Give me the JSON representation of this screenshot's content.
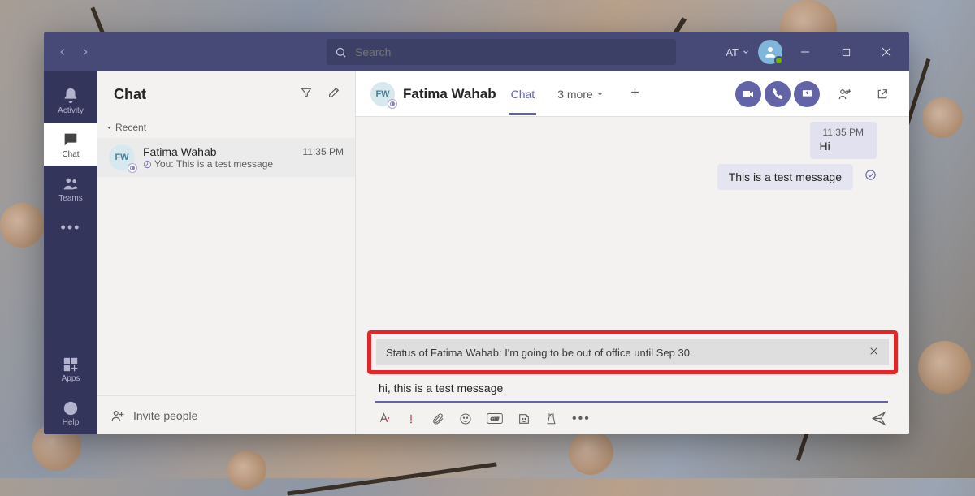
{
  "titlebar": {
    "search_placeholder": "Search",
    "tenant_label": "AT"
  },
  "rail": {
    "activity": "Activity",
    "chat": "Chat",
    "teams": "Teams",
    "more": "···",
    "apps": "Apps",
    "help": "Help"
  },
  "chat_list": {
    "title": "Chat",
    "section_recent": "Recent",
    "items": [
      {
        "name": "Fatima Wahab",
        "initials": "FW",
        "preview": "You: This is a test message",
        "time": "11:35 PM"
      }
    ],
    "invite_label": "Invite people"
  },
  "chat_header": {
    "initials": "FW",
    "name": "Fatima Wahab",
    "active_tab": "Chat",
    "more_tabs": "3 more"
  },
  "messages": {
    "time": "11:35 PM",
    "m1": "Hi",
    "m2": "This is a test message"
  },
  "status_banner": "Status of Fatima Wahab: I'm going to be out of office until Sep 30.",
  "compose": {
    "value": "hi, this is a test message"
  }
}
